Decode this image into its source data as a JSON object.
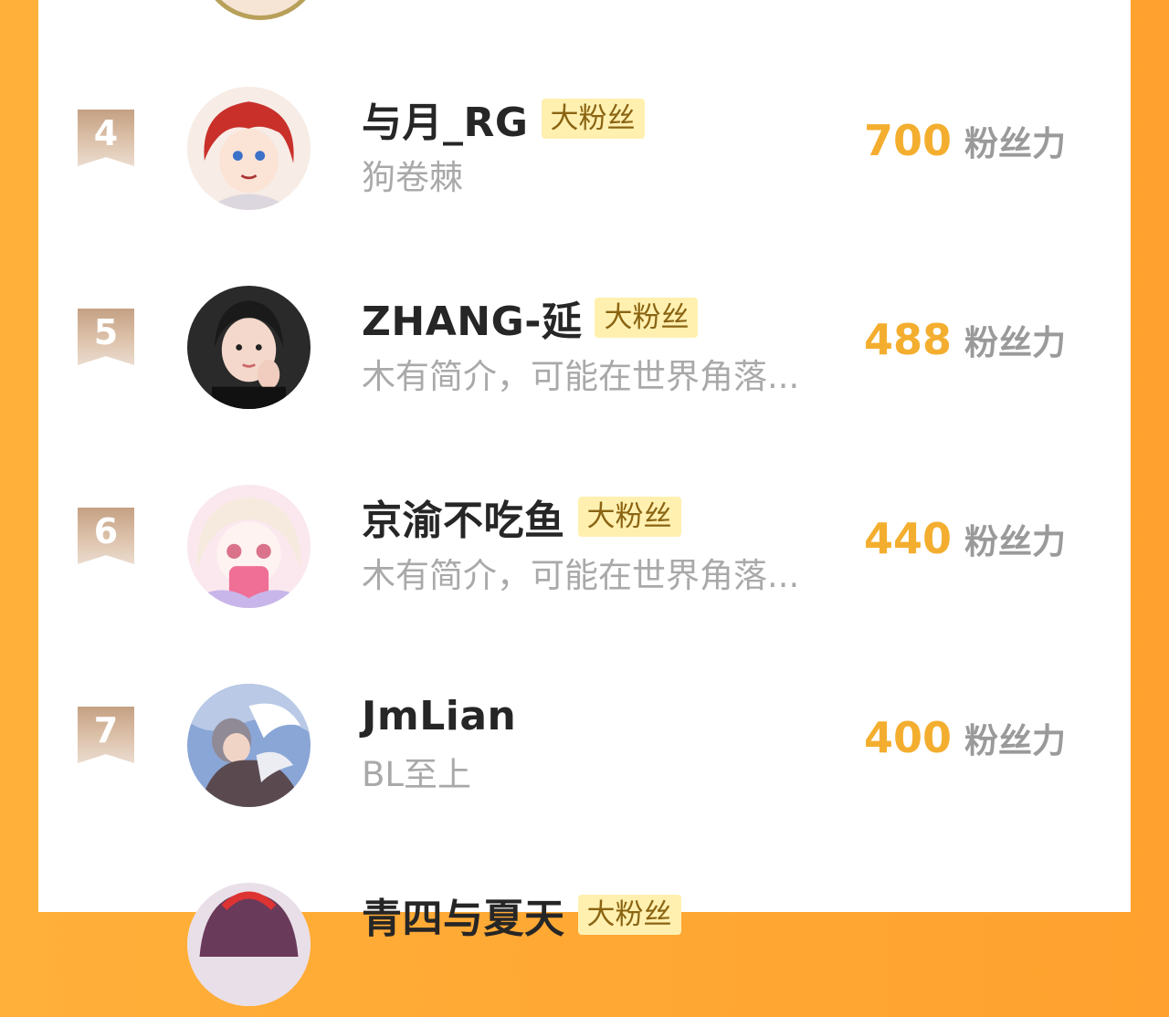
{
  "rows": [
    {
      "rank": "4",
      "name": "与月_RG",
      "badge": "大粉丝",
      "bio": "狗卷棘",
      "score": "700",
      "unit": "粉丝力",
      "avatar": "anime-red-hair-avatar"
    },
    {
      "rank": "5",
      "name": "ZHANG-延",
      "badge": "大粉丝",
      "bio": "木有简介，可能在世界角落...",
      "score": "488",
      "unit": "粉丝力",
      "avatar": "girl-photo-avatar"
    },
    {
      "rank": "6",
      "name": "京渝不吃鱼",
      "badge": "大粉丝",
      "bio": "木有简介，可能在世界角落...",
      "score": "440",
      "unit": "粉丝力",
      "avatar": "anime-pink-girl-avatar"
    },
    {
      "rank": "7",
      "name": "JmLian",
      "badge": "",
      "bio": "BL至上",
      "score": "400",
      "unit": "粉丝力",
      "avatar": "anime-illustration-avatar"
    }
  ],
  "next_row": {
    "name": "青四与夏天",
    "badge": "大粉丝"
  },
  "colors": {
    "background": "#ffa12e",
    "score": "#f4ae2f",
    "badge_bg": "#fff0b0",
    "rank_ribbon": "#c4a183"
  }
}
